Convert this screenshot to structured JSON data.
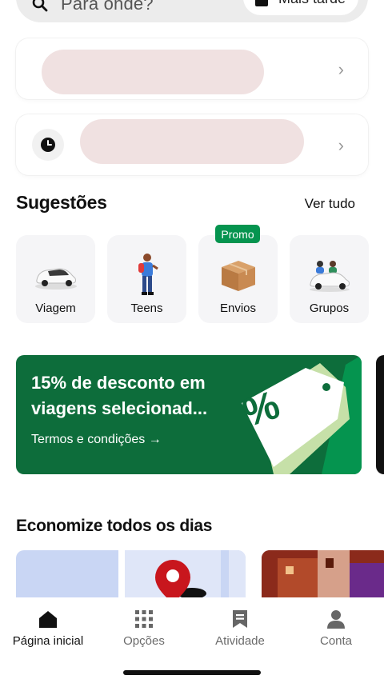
{
  "search": {
    "placeholder": "Para onde?",
    "later_label": "Mais tarde"
  },
  "recent_places": [
    {
      "icon": "location-icon"
    },
    {
      "icon": "clock-icon"
    }
  ],
  "suggestions": {
    "title": "Sugestões",
    "see_all": "Ver tudo",
    "promo_badge": "Promo",
    "items": [
      {
        "label": "Viagem",
        "icon": "car-icon"
      },
      {
        "label": "Teens",
        "icon": "teen-icon"
      },
      {
        "label": "Envios",
        "icon": "package-icon"
      },
      {
        "label": "Grupos",
        "icon": "group-car-icon"
      }
    ]
  },
  "banner": {
    "title_line1": "15% de desconto em",
    "title_line2": "viagens selecionad...",
    "link": "Termos e condições →",
    "tag_text": "%",
    "colors": {
      "bg": "#0d6d3b",
      "accent": "#05944f"
    }
  },
  "savings": {
    "title": "Economize todos os dias"
  },
  "nav": {
    "items": [
      {
        "label": "Página inicial",
        "icon": "home-icon",
        "active": true
      },
      {
        "label": "Opções",
        "icon": "grid-icon",
        "active": false
      },
      {
        "label": "Atividade",
        "icon": "receipt-icon",
        "active": false
      },
      {
        "label": "Conta",
        "icon": "person-icon",
        "active": false
      }
    ]
  }
}
